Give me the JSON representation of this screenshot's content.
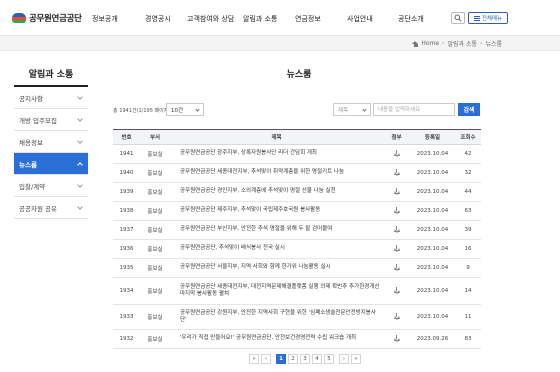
{
  "header": {
    "logo_text": "공무원연금공단",
    "nav": [
      "정보공개",
      "경영공시",
      "고객참여와 상담",
      "알림과 소통",
      "연금정보",
      "사업안내",
      "공단소개"
    ],
    "all_menu_label": "전체메뉴"
  },
  "breadcrumb": [
    "Home",
    "알림과 소통",
    "뉴스룸"
  ],
  "sidebar": {
    "title": "알림과 소통",
    "items": [
      {
        "label": "공지사항"
      },
      {
        "label": "개방 입주모집"
      },
      {
        "label": "채용정보"
      },
      {
        "label": "뉴스룸"
      },
      {
        "label": "입찰/계약"
      },
      {
        "label": "공공자원 공유"
      }
    ],
    "active_index": 3
  },
  "main": {
    "title": "뉴스룸",
    "count_text": "총 1941건(1/195 페이지)",
    "page_size": "10건",
    "search_field": "제목",
    "search_placeholder": "내용을 입력하세요",
    "search_button": "검색"
  },
  "table": {
    "headers": [
      "번호",
      "부서",
      "제목",
      "첨부",
      "등록일",
      "조회수"
    ],
    "rows": [
      {
        "no": "1941",
        "dept": "홍보실",
        "title": "공무원연금공단 광주지부, 상록자원봉사단 리더 간담회 개최",
        "date": "2023.10.04",
        "views": "42"
      },
      {
        "no": "1940",
        "dept": "홍보실",
        "title": "공무원연금공단 세종대전지부, 추석맞이 취약계층을 위한 명절키트 나눔",
        "date": "2023.10.04",
        "views": "32"
      },
      {
        "no": "1939",
        "dept": "홍보실",
        "title": "공무원연금공단 경인지부, 소외계층에 추석맞이 명절 선물 나눔 실천",
        "date": "2023.10.04",
        "views": "44"
      },
      {
        "no": "1938",
        "dept": "홍보실",
        "title": "공무원연금공단 제주지부, 추석맞이 국립제주호국원 봉사활동",
        "date": "2023.10.04",
        "views": "63"
      },
      {
        "no": "1937",
        "dept": "홍보실",
        "title": "공무원연금공단 부산지부, 안전한 추석 명절을 위해 두 팔 걷어붙여",
        "date": "2023.10.04",
        "views": "39"
      },
      {
        "no": "1936",
        "dept": "홍보실",
        "title": "공무원연금공단, 추석맞이 배식봉사 전국 실시",
        "date": "2023.10.04",
        "views": "16"
      },
      {
        "no": "1935",
        "dept": "홍보실",
        "title": "공무원연금공단 서울지부, 지역 사회와 함께 한가위 나눔활동 실시",
        "date": "2023.10.04",
        "views": "9"
      },
      {
        "no": "1934",
        "dept": "홍보실",
        "title": "공무원연금공단 세종대전지부, 대전지역문제해결플랫폼 실행 의제 확반추 추가한경개선 마지막 봉사활동 펼쳐",
        "date": "2023.10.04",
        "views": "14"
      },
      {
        "no": "1933",
        "dept": "홍보실",
        "title": "공무원연금공단 강원지부, 안전한 지역사회 구현을 위한 '심폐소생술전문안전방지봉사단'",
        "date": "2023.10.04",
        "views": "11"
      },
      {
        "no": "1932",
        "dept": "홍보실",
        "title": "'우리가 직접 만들어요!' 공무원연금공단, 안전보건경영전략 수립 워크숍 개최",
        "date": "2023.09.26",
        "views": "83"
      }
    ]
  },
  "pagination": {
    "first": "«",
    "prev": "‹",
    "pages": [
      "1",
      "2",
      "3",
      "4",
      "5"
    ],
    "current": "1",
    "next": "›",
    "last": "»"
  },
  "colors": {
    "accent": "#2a6fd6",
    "logo_blue": "#2f5fb3",
    "logo_red": "#e84b3a",
    "logo_green": "#3aa34a"
  }
}
